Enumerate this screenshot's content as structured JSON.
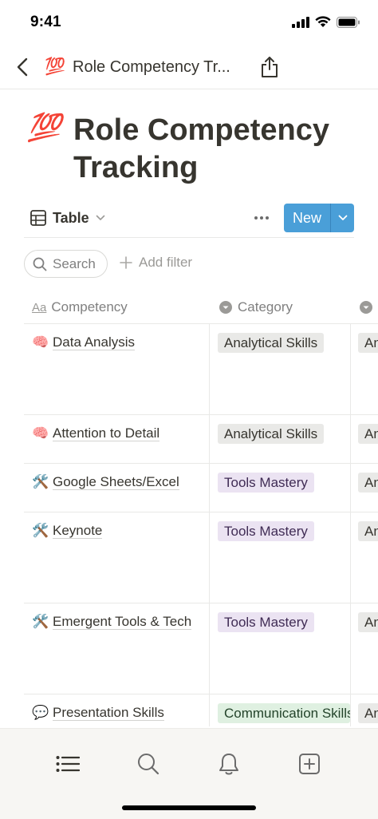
{
  "status_bar": {
    "time": "9:41",
    "icons": [
      "signal-icon",
      "wifi-icon",
      "battery-icon"
    ]
  },
  "nav": {
    "back_icon": "chevron-left-icon",
    "emoji": "💯",
    "title": "Role Competency Tr...",
    "share_icon": "share-icon"
  },
  "page": {
    "emoji": "💯",
    "title": "Role Competency Tracking"
  },
  "view_bar": {
    "view_icon": "table-icon",
    "view_label": "Table",
    "more_icon": "more-icon",
    "new_label": "New",
    "new_dropdown_icon": "chevron-down-icon",
    "accent_color": "#4a9fd8"
  },
  "toolbar": {
    "search_label": "Search",
    "add_filter_label": "Add filter"
  },
  "table": {
    "columns": [
      {
        "label": "Competency",
        "icon": "text-property-icon"
      },
      {
        "label": "Category",
        "icon": "select-property-icon"
      },
      {
        "label": "",
        "icon": "select-property-icon"
      }
    ],
    "rows": [
      {
        "emoji": "🧠",
        "name": "Data Analysis",
        "category": "Analytical Skills",
        "peek": "An"
      },
      {
        "emoji": "🧠",
        "name": "Attention to Detail",
        "category": "Analytical Skills",
        "peek": "An"
      },
      {
        "emoji": "🛠️",
        "name": "Google Sheets/Excel",
        "category": "Tools Mastery",
        "peek": "An"
      },
      {
        "emoji": "🛠️",
        "name": "Keynote",
        "category": "Tools Mastery",
        "peek": "An"
      },
      {
        "emoji": "🛠️",
        "name": "Emergent Tools & Tech",
        "category": "Tools Mastery",
        "peek": "An"
      },
      {
        "emoji": "💬",
        "name": "Presentation Skills",
        "category": "Communication Skills",
        "peek": "An"
      }
    ],
    "tag_colors": {
      "Analytical Skills": "#e9e9e7",
      "Tools Mastery": "#ebe3f2",
      "Communication Skills": "#dff0e1"
    }
  },
  "tab_bar": {
    "tabs": [
      "list-icon",
      "search-icon",
      "bell-icon",
      "add-page-icon"
    ]
  }
}
